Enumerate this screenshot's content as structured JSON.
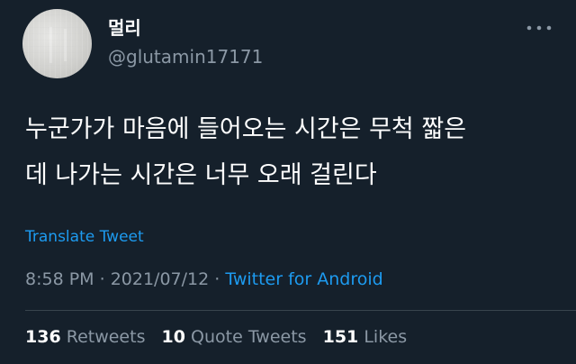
{
  "user": {
    "display_name": "멀리",
    "handle": "@glutamin17171"
  },
  "tweet": {
    "text_lines": [
      "누군가가 마음에 들어오는 시간은 무척 짧은",
      "데 나가는 시간은 너무 오래 걸린다"
    ],
    "translate_label": "Translate Tweet",
    "time": "8:58 PM",
    "date": "2021/07/12",
    "separator": "·",
    "source": "Twitter for Android"
  },
  "stats": {
    "retweets_count": "136",
    "retweets_label": "Retweets",
    "quotes_count": "10",
    "quotes_label": "Quote Tweets",
    "likes_count": "151",
    "likes_label": "Likes"
  },
  "icons": {
    "more": "more-horizontal-icon"
  },
  "colors": {
    "background": "#15202b",
    "text": "#ffffff",
    "secondary": "#8b98a5",
    "accent": "#1d9bf0"
  }
}
